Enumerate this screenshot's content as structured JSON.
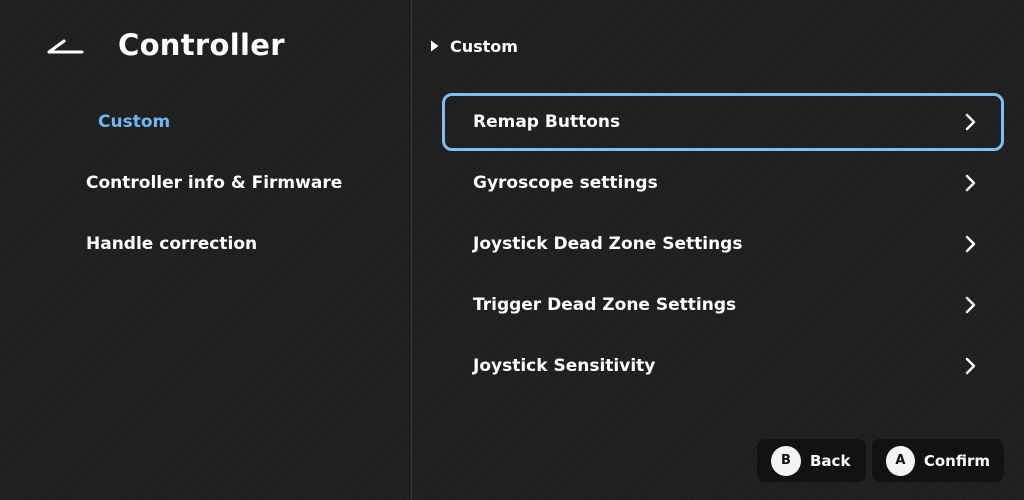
{
  "header": {
    "title": "Controller"
  },
  "sidebar": {
    "items": [
      {
        "label": "Custom"
      },
      {
        "label": "Controller info & Firmware"
      },
      {
        "label": "Handle correction"
      }
    ]
  },
  "breadcrumb": {
    "label": "Custom"
  },
  "menu": {
    "items": [
      {
        "label": "Remap Buttons"
      },
      {
        "label": "Gyroscope settings"
      },
      {
        "label": "Joystick Dead Zone Settings"
      },
      {
        "label": "Trigger Dead Zone Settings"
      },
      {
        "label": "Joystick Sensitivity"
      }
    ]
  },
  "hints": {
    "back": {
      "key": "B",
      "label": "Back"
    },
    "confirm": {
      "key": "A",
      "label": "Confirm"
    }
  },
  "colors": {
    "accent": "#6fb6f2",
    "selection_border": "#7dbef5",
    "background": "#1f1f1f"
  },
  "icons": {
    "back": "back-arrow-icon",
    "breadcrumb": "triangle-right-icon",
    "menu_chevron": "chevron-right-icon"
  }
}
